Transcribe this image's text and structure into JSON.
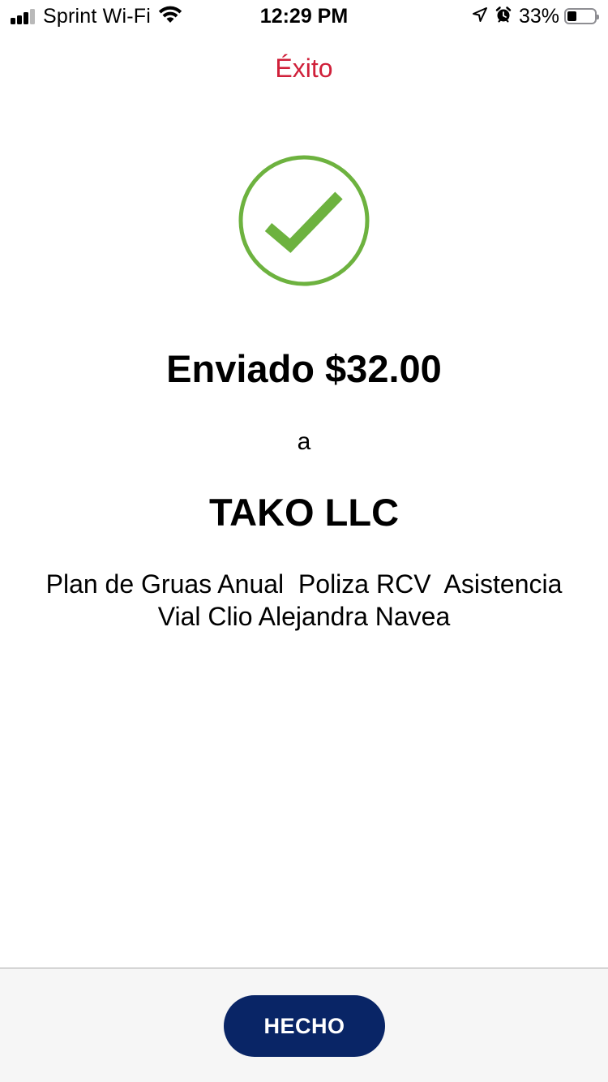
{
  "status_bar": {
    "carrier": "Sprint Wi-Fi",
    "time": "12:29 PM",
    "battery_percent": "33%",
    "battery_level": 0.33,
    "icons": [
      "signal-icon",
      "wifi-icon",
      "location-icon",
      "alarm-icon",
      "battery-icon"
    ]
  },
  "nav": {
    "title": "Éxito"
  },
  "result": {
    "status_icon": "check-circle-icon",
    "sent_amount": "Enviado $32.00",
    "to_label": "a",
    "recipient": "TAKO LLC",
    "memo": "Plan de Gruas Anual  Poliza RCV  Asistencia Vial Clio Alejandra Navea"
  },
  "footer": {
    "done_label": "HECHO"
  },
  "colors": {
    "title_red": "#d0203a",
    "success_green": "#6db23f",
    "button_navy": "#092566",
    "footer_bg": "#f6f6f6"
  }
}
